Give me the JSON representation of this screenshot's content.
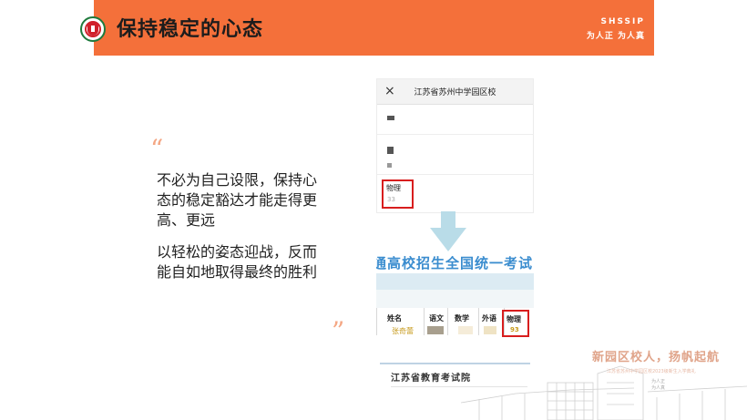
{
  "header": {
    "title": "保持稳定的心态",
    "brand_code": "SHSSIP",
    "motto": "为人正 为人真",
    "color": "#f4703a"
  },
  "quote": {
    "open_mark": "“",
    "close_mark": "”",
    "paragraphs": [
      "不必为自己设限，保持心态的稳定豁达才能走得更高、更远",
      "以轻松的姿态迎战，反而能自如地取得最终的胜利"
    ]
  },
  "phone": {
    "close_icon": "×",
    "title": "江苏省苏州中学园区校",
    "subject": "物理",
    "score": "33"
  },
  "result_doc": {
    "header_text": "通高校招生全国统一考试",
    "columns": [
      "姓名",
      "语文",
      "数学",
      "外语",
      "物理"
    ],
    "name": "张奇蕾",
    "physics_score": "93",
    "issuer": "江苏省教育考试院"
  },
  "decoration": {
    "slogan": "新园区校人，扬帆起航",
    "sub": "江苏省苏州中学园区校2023级新生入学典礼",
    "motto_lines": [
      "为人正",
      "为人真"
    ],
    "accent": "#e0a48a"
  }
}
